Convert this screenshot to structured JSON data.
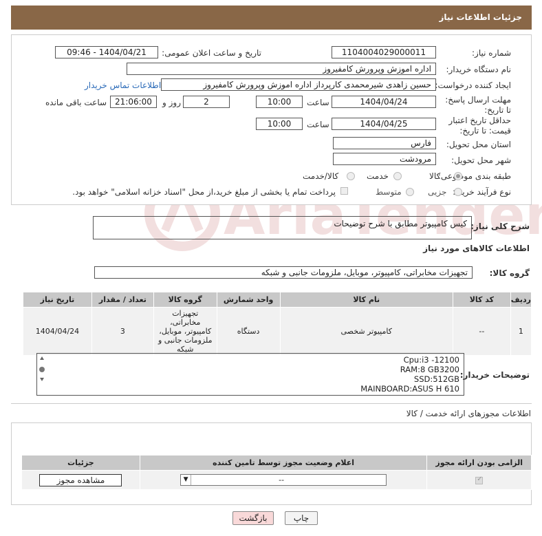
{
  "header": {
    "title": "جزئیات اطلاعات نیاز"
  },
  "form": {
    "need_number_label": "شماره نیاز:",
    "need_number": "1104004029000011",
    "announce_label": "تاریخ و ساعت اعلان عمومی:",
    "announce_value": "1404/04/21 - 09:46",
    "buyer_org_label": "نام دستگاه خریدار:",
    "buyer_org": "اداره اموزش وپرورش کامفیروز",
    "creator_label": "ایجاد کننده درخواست:",
    "creator": "حسین زاهدی شیرمحمدی کارپرداز اداره اموزش وپرورش کامفیروز",
    "contact_link": "اطلاعات تماس خریدار",
    "deadline_label": "مهلت ارسال پاسخ: تا تاریخ:",
    "deadline_date": "1404/04/24",
    "time_label": "ساعت",
    "deadline_time": "10:00",
    "days_value": "2",
    "days_label": "روز و",
    "remaining_time": "21:06:00",
    "remaining_label": "ساعت باقی مانده",
    "validity_label": "حداقل تاریخ اعتبار قیمت: تا تاریخ:",
    "validity_date": "1404/04/25",
    "validity_time": "10:00",
    "province_label": "استان محل تحویل:",
    "province": "فارس",
    "city_label": "شهر محل تحویل:",
    "city": "مرودشت",
    "category_label": "طبقه بندی موضوعی:",
    "category_options": [
      "کالا",
      "خدمت",
      "کالا/خدمت"
    ],
    "category_selected": "کالا",
    "process_label": "نوع فرآیند خرید :",
    "process_options": [
      "جزیی",
      "متوسط"
    ],
    "payment_note": "پرداخت تمام یا بخشی از مبلغ خرید،از محل \"اسناد خزانه اسلامی\" خواهد بود."
  },
  "description": {
    "label": "شرح کلی نیاز:",
    "value": "کیس کامپیوتر مطابق با شرح توضیحات"
  },
  "items_section": {
    "title": "اطلاعات کالاهای مورد نیاز",
    "group_label": "گروه کالا:",
    "group_value": "تجهیزات مخابراتی، کامپیوتر، موبایل، ملزومات جانبی و شبکه",
    "columns": [
      "ردیف",
      "کد کالا",
      "نام کالا",
      "واحد شمارش",
      "گروه کالا",
      "تعداد / مقدار",
      "تاریخ نیاز"
    ],
    "rows": [
      {
        "index": "1",
        "code": "--",
        "name": "کامپیوتر شخصی",
        "unit": "دستگاه",
        "group": "تجهیزات مخابراتی، کامپیوتر، موبایل، ملزومات جانبی و شبکه",
        "qty": "3",
        "date": "1404/04/24"
      }
    ]
  },
  "buyer_notes": {
    "label": "توضیحات خریدار:",
    "lines": [
      "Cpu:i3 -12100",
      "RAM:8 GB3200",
      "SSD:512GB",
      "MAINBOARD:ASUS H 610"
    ]
  },
  "permits": {
    "title": "اطلاعات مجوزهای ارائه خدمت / کالا",
    "columns": [
      "الزامی بودن ارائه مجوز",
      "اعلام وضعیت مجوز توسط تامین کننده",
      "جزئیات"
    ],
    "select_value": "--",
    "view_button": "مشاهده مجوز"
  },
  "actions": {
    "print": "چاپ",
    "back": "بازگشت"
  },
  "watermark": "AriaTender.neT"
}
